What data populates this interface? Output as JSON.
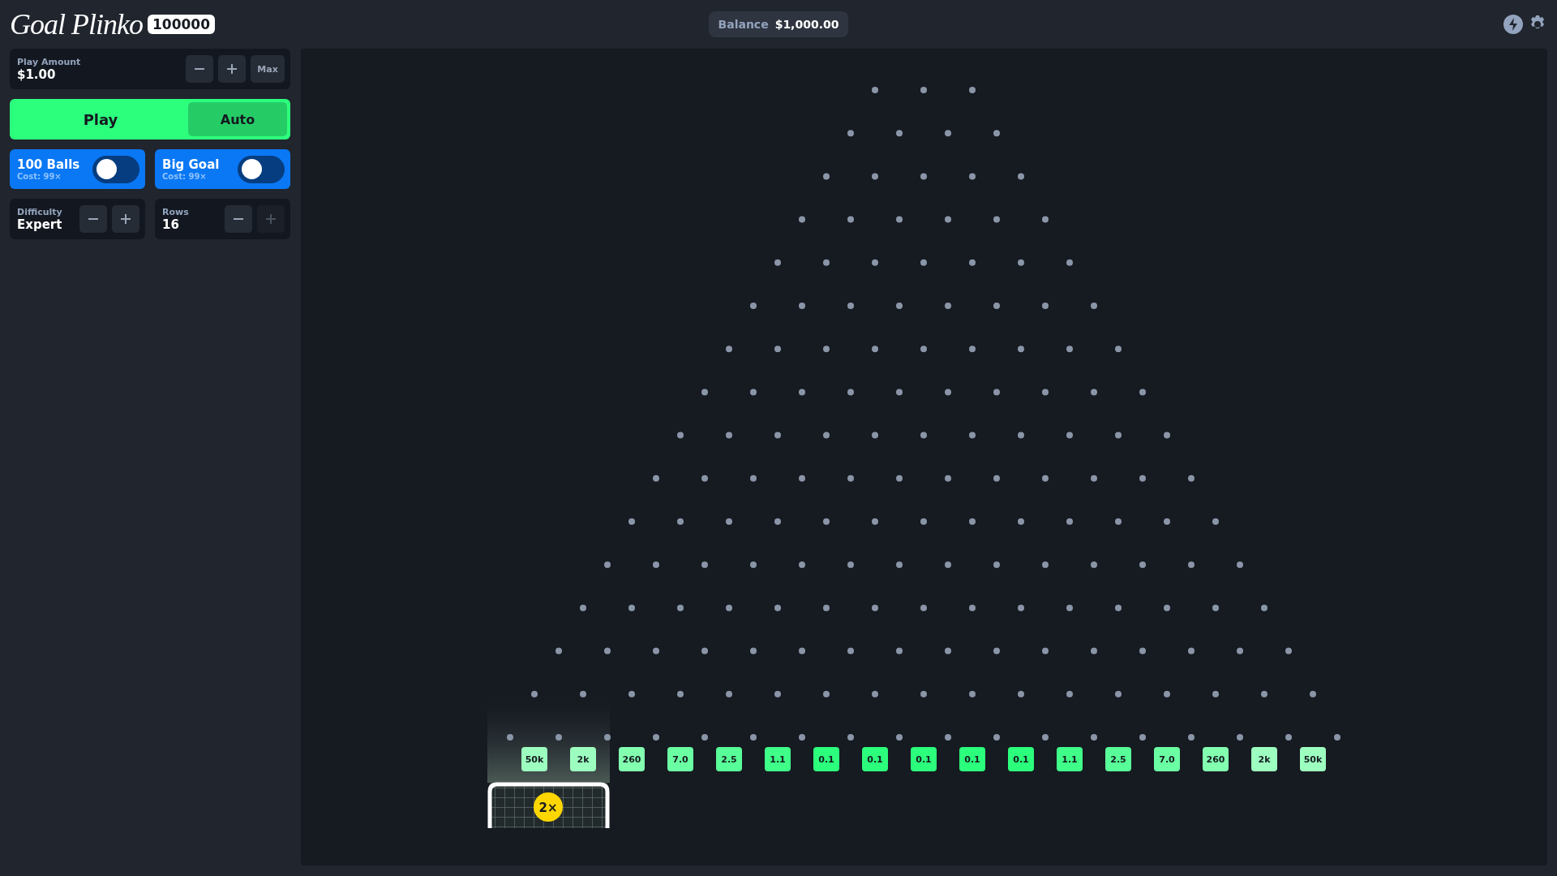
{
  "header": {
    "logo": "Goal Plinko",
    "badge": "100000",
    "balance_label": "Balance",
    "balance_value": "$1,000.00"
  },
  "play_amount": {
    "label": "Play Amount",
    "value": "$1.00",
    "max_label": "Max"
  },
  "play_button": "Play",
  "auto_button": "Auto",
  "toggles": [
    {
      "title": "100 Balls",
      "cost": "Cost: 99×",
      "on": false
    },
    {
      "title": "Big Goal",
      "cost": "Cost: 99×",
      "on": false
    }
  ],
  "steppers": [
    {
      "label": "Difficulty",
      "value": "Expert",
      "minus_disabled": false,
      "plus_disabled": false
    },
    {
      "label": "Rows",
      "value": "16",
      "minus_disabled": false,
      "plus_disabled": true
    }
  ],
  "board": {
    "slots": [
      {
        "label": "50k",
        "color": "#9dffbf"
      },
      {
        "label": "2k",
        "color": "#9dffbf"
      },
      {
        "label": "260",
        "color": "#83ffb0"
      },
      {
        "label": "7.0",
        "color": "#6bffa3"
      },
      {
        "label": "2.5",
        "color": "#58ff98"
      },
      {
        "label": "1.1",
        "color": "#3fff89"
      },
      {
        "label": "0.1",
        "color": "#2bff7c"
      },
      {
        "label": "0.1",
        "color": "#2bff7c"
      },
      {
        "label": "0.1",
        "color": "#2bff7c"
      },
      {
        "label": "0.1",
        "color": "#2bff7c"
      },
      {
        "label": "0.1",
        "color": "#2bff7c"
      },
      {
        "label": "1.1",
        "color": "#3fff89"
      },
      {
        "label": "2.5",
        "color": "#58ff98"
      },
      {
        "label": "7.0",
        "color": "#6bffa3"
      },
      {
        "label": "260",
        "color": "#83ffb0"
      },
      {
        "label": "2k",
        "color": "#9dffbf"
      },
      {
        "label": "50k",
        "color": "#9dffbf"
      }
    ],
    "goal_multiplier": "2×"
  }
}
